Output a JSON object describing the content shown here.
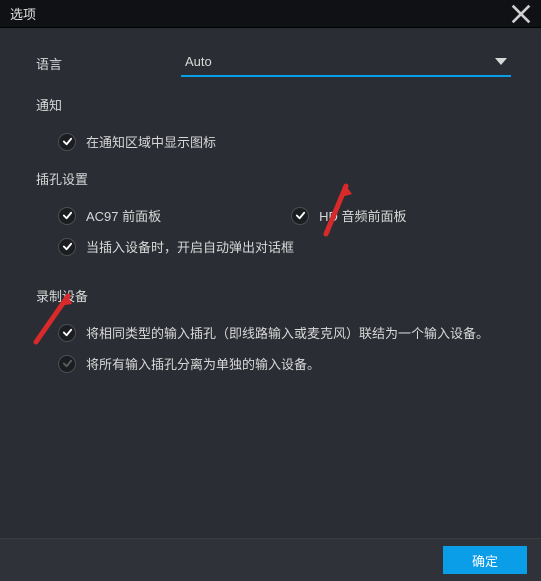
{
  "window": {
    "title": "选项"
  },
  "language": {
    "label": "语言",
    "value": "Auto"
  },
  "notification": {
    "label": "通知",
    "show_icon": {
      "label": "在通知区域中显示图标",
      "checked": true
    }
  },
  "jack": {
    "label": "插孔设置",
    "ac97": {
      "label": "AC97 前面板",
      "checked": true
    },
    "hd": {
      "label": "HD 音频前面板",
      "checked": true
    },
    "auto_popup": {
      "label": "当插入设备时，开启自动弹出对话框",
      "checked": true
    }
  },
  "recording": {
    "label": "录制设备",
    "group_same": {
      "label": "将相同类型的输入插孔（即线路输入或麦克风）联结为一个输入设备。",
      "checked": true
    },
    "separate": {
      "label": "将所有输入插孔分离为单独的输入设备。",
      "checked": false
    }
  },
  "footer": {
    "ok": "确定"
  },
  "colors": {
    "accent": "#0a9de8",
    "arrow": "#d82a2a"
  }
}
